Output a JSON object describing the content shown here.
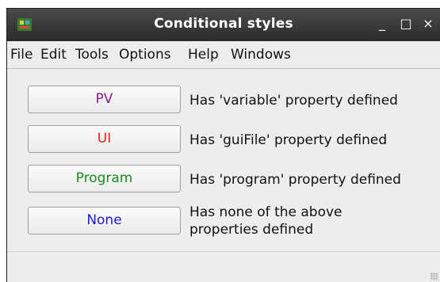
{
  "window": {
    "title": "Conditional styles",
    "controls": {
      "minimize": "_",
      "maximize": "□",
      "close": "×"
    }
  },
  "menu": [
    "File",
    "Edit",
    "Tools",
    "Options",
    "Help",
    "Windows"
  ],
  "rows": [
    {
      "button": "PV",
      "color": "#8b1a8b",
      "description": "Has 'variable' property defined"
    },
    {
      "button": "UI",
      "color": "#e0201c",
      "description": "Has 'guiFile' property defined"
    },
    {
      "button": "Program",
      "color": "#1a8a1a",
      "description": "Has 'program' property defined"
    },
    {
      "button": "None",
      "color": "#1c1cd8",
      "description_lines": [
        "Has none of the above",
        "properties defined"
      ]
    }
  ]
}
